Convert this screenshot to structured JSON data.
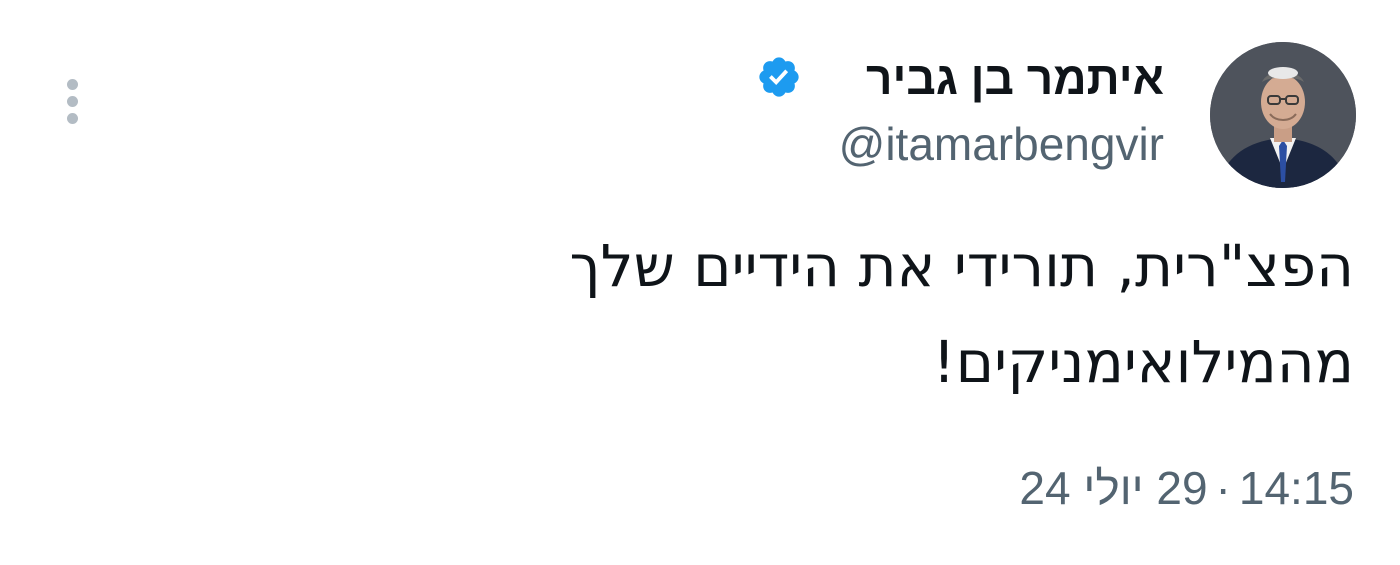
{
  "author": {
    "display_name": "איתמר בן גביר",
    "handle": "@itamarbengvir",
    "verified": true,
    "verified_color": "#1d9bf0",
    "avatar_icon": "profile-photo"
  },
  "menu": {
    "icon": "more-vertical-icon"
  },
  "tweet": {
    "line1": "הפצ\"רית, תורידי את הידיים שלך",
    "line2": "מהמילואימניקים!"
  },
  "meta": {
    "time": "14:15",
    "separator": "·",
    "date": "29 יולי 24"
  }
}
